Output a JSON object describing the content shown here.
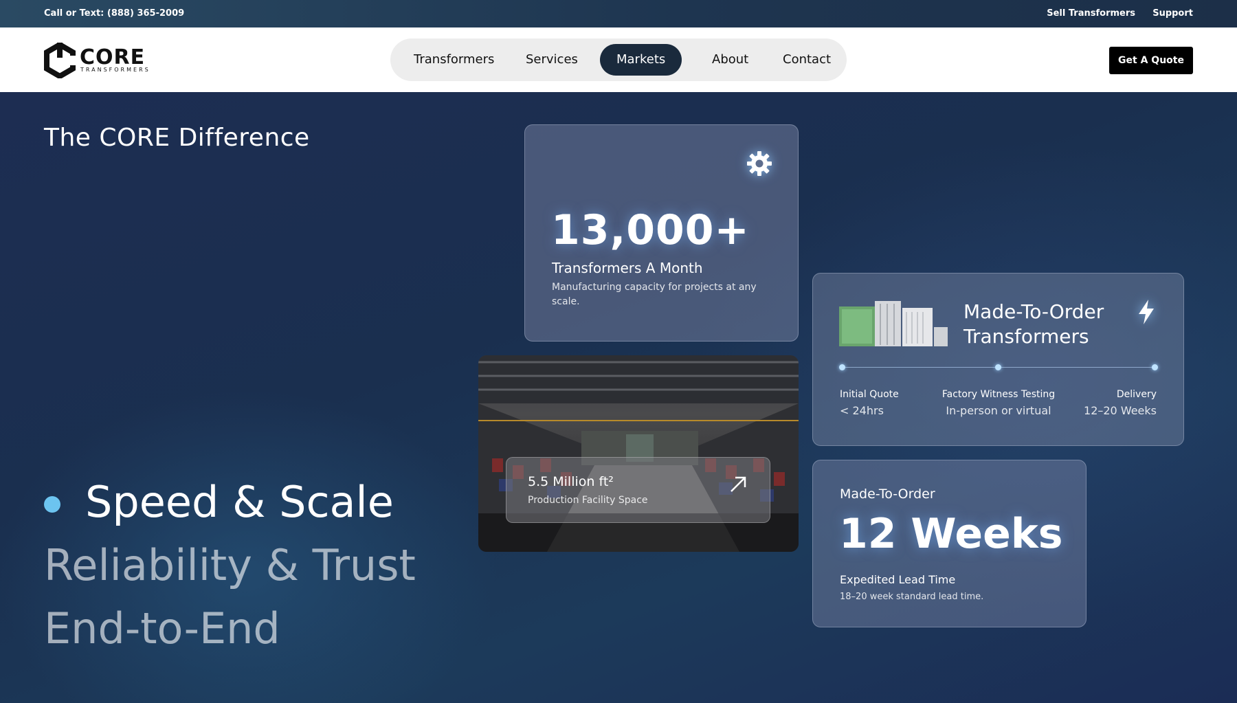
{
  "topbar": {
    "phone": "Call or Text: (888) 365-2009",
    "links": [
      "Sell Transformers",
      "Support"
    ]
  },
  "nav": {
    "logo_word": "CORE",
    "logo_sub": "TRANSFORMERS",
    "items": [
      "Transformers",
      "Services",
      "Markets",
      "About",
      "Contact"
    ],
    "active_item": "Markets",
    "cta": "Get A Quote"
  },
  "hero": {
    "title": "The CORE Difference",
    "features": [
      "Speed & Scale",
      "Reliability & Trust",
      "End-to-End"
    ],
    "active_feature": "Speed & Scale"
  },
  "capacity_card": {
    "value": "13,000+",
    "label": "Transformers A Month",
    "description": "Manufacturing capacity for projects at any scale.",
    "icon": "gear-icon"
  },
  "facility_card": {
    "title": "5.5 Million ft²",
    "subtitle": "Production Facility Space",
    "icon": "arrow-up-right-icon"
  },
  "mto_card": {
    "title": "Made-To-Order Transformers",
    "icon": "lightning-icon",
    "steps": [
      {
        "label": "Initial Quote",
        "value": "< 24hrs"
      },
      {
        "label": "Factory Witness Testing",
        "value": "In-person or virtual"
      },
      {
        "label": "Delivery",
        "value": "12–20 Weeks"
      }
    ]
  },
  "lead_card": {
    "eyebrow": "Made-To-Order",
    "value": "12 Weeks",
    "label": "Expedited Lead Time",
    "description": "18–20 week standard lead time."
  },
  "colors": {
    "accent": "#6cc4f0",
    "nav_active": "#1a2a3c",
    "cta_bg": "#000000"
  }
}
